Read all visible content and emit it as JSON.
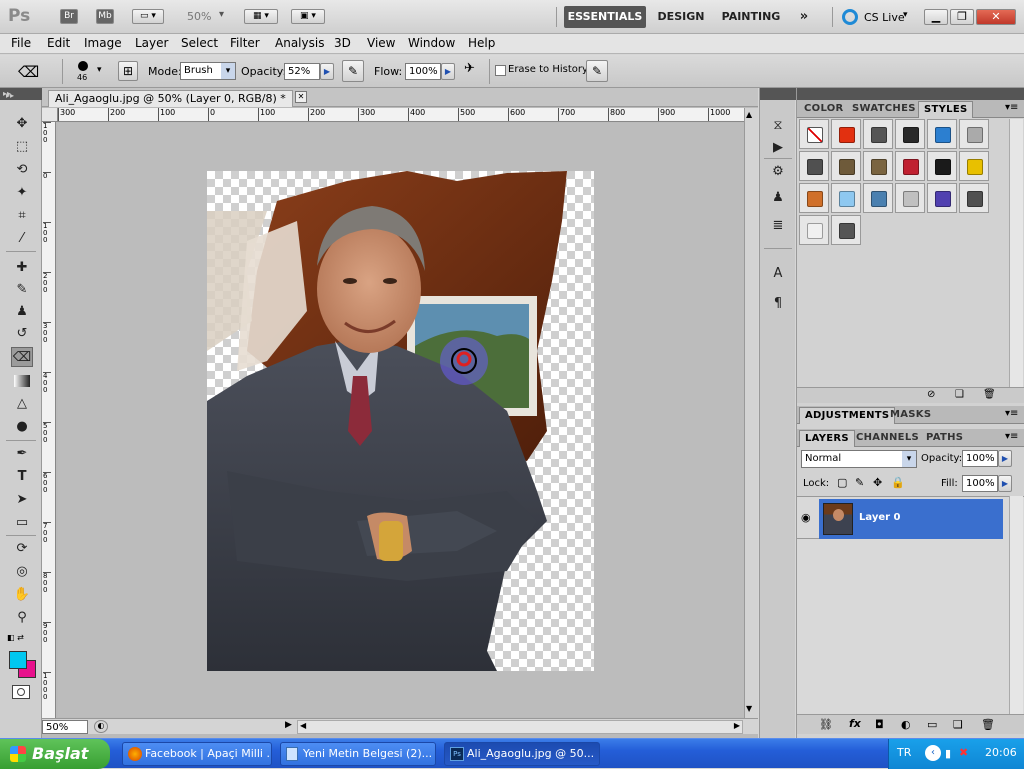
{
  "app": {
    "logo": "Ps",
    "br": "Br",
    "mb": "Mb",
    "zoom": "50%"
  },
  "workspaces": [
    "ESSENTIALS",
    "DESIGN",
    "PAINTING"
  ],
  "cslive": "CS Live",
  "menu": [
    "File",
    "Edit",
    "Image",
    "Layer",
    "Select",
    "Filter",
    "Analysis",
    "3D",
    "View",
    "Window",
    "Help"
  ],
  "options": {
    "brush_size": "46",
    "mode_label": "Mode:",
    "mode_value": "Brush",
    "opacity_label": "Opacity:",
    "opacity_value": "52%",
    "flow_label": "Flow:",
    "flow_value": "100%",
    "erase_history": "Erase to History"
  },
  "document": {
    "tab_title": "Ali_Agaoglu.jpg @ 50% (Layer 0, RGB/8) *",
    "zoom_status": "50%",
    "ruler_h": [
      "300",
      "200",
      "100",
      "0",
      "100",
      "200",
      "300",
      "400",
      "500",
      "600",
      "700",
      "800",
      "900",
      "1000"
    ],
    "ruler_v": [
      "1 0 0",
      "0",
      "1 0 0",
      "2 0 0",
      "3 0 0",
      "4 0 0",
      "5 0 0",
      "6 0 0",
      "7 0 0",
      "8 0 0",
      "9 0 0",
      "1 0 0 0"
    ]
  },
  "styles_panel": {
    "tabs": [
      "COLOR",
      "SWATCHES",
      "STYLES"
    ],
    "active_tab": "STYLES",
    "swatch_colors": [
      "none",
      "#e23010",
      "#555555",
      "#2a2a2a",
      "#2c7fd0",
      "#aaaaaa",
      "#505050",
      "#6e5a3a",
      "#7a6440",
      "#c02030",
      "#1a1a1a",
      "#e8c000",
      "#d0702a",
      "#8ec8f0",
      "#4a80b0",
      "#c0c0c0",
      "#5040b0",
      "#505050",
      "#f0f0f0",
      "#555555"
    ]
  },
  "adjustments_panel": {
    "tabs": [
      "ADJUSTMENTS",
      "MASKS"
    ]
  },
  "layers_panel": {
    "tabs": [
      "LAYERS",
      "CHANNELS",
      "PATHS"
    ],
    "blend_mode": "Normal",
    "opacity_label": "Opacity:",
    "opacity_value": "100%",
    "lock_label": "Lock:",
    "fill_label": "Fill:",
    "fill_value": "100%",
    "layers": [
      {
        "name": "Layer 0",
        "visible": true,
        "selected": true
      }
    ]
  },
  "colors": {
    "foreground": "#00c8f0",
    "background": "#e8108c",
    "selection": "#3a6fce"
  },
  "taskbar": {
    "start": "Başlat",
    "tasks": [
      "Facebook | Apaçi Milli ...",
      "Yeni Metin Belgesi (2)...",
      "Ali_Agaoglu.jpg @ 50..."
    ],
    "language": "TR",
    "clock": "20:06"
  }
}
